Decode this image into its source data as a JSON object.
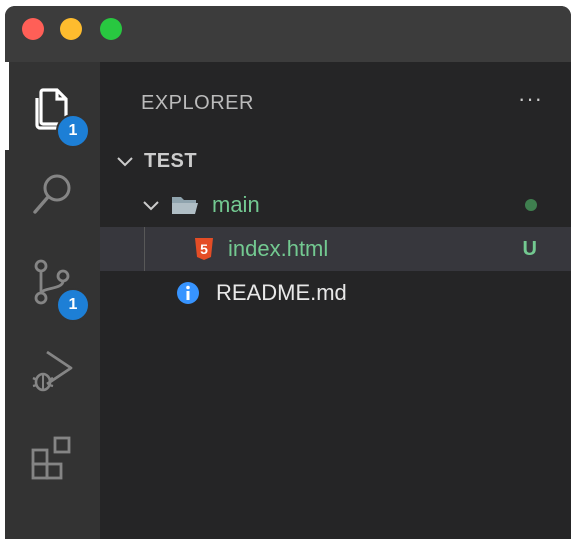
{
  "activity_bar": {
    "explorer_badge": "1",
    "source_control_badge": "1"
  },
  "sidebar": {
    "title": "EXPLORER",
    "more_actions": "···",
    "workspace": "TEST",
    "tree": {
      "folder_name": "main",
      "file_index": "index.html",
      "file_index_status": "U",
      "file_index_icon_glyph": "5",
      "file_readme": "README.md"
    }
  },
  "colors": {
    "accent_badge": "#1d7fd6",
    "git_untracked": "#73c991",
    "html_icon": "#e44d26",
    "info_icon": "#3794ff"
  }
}
